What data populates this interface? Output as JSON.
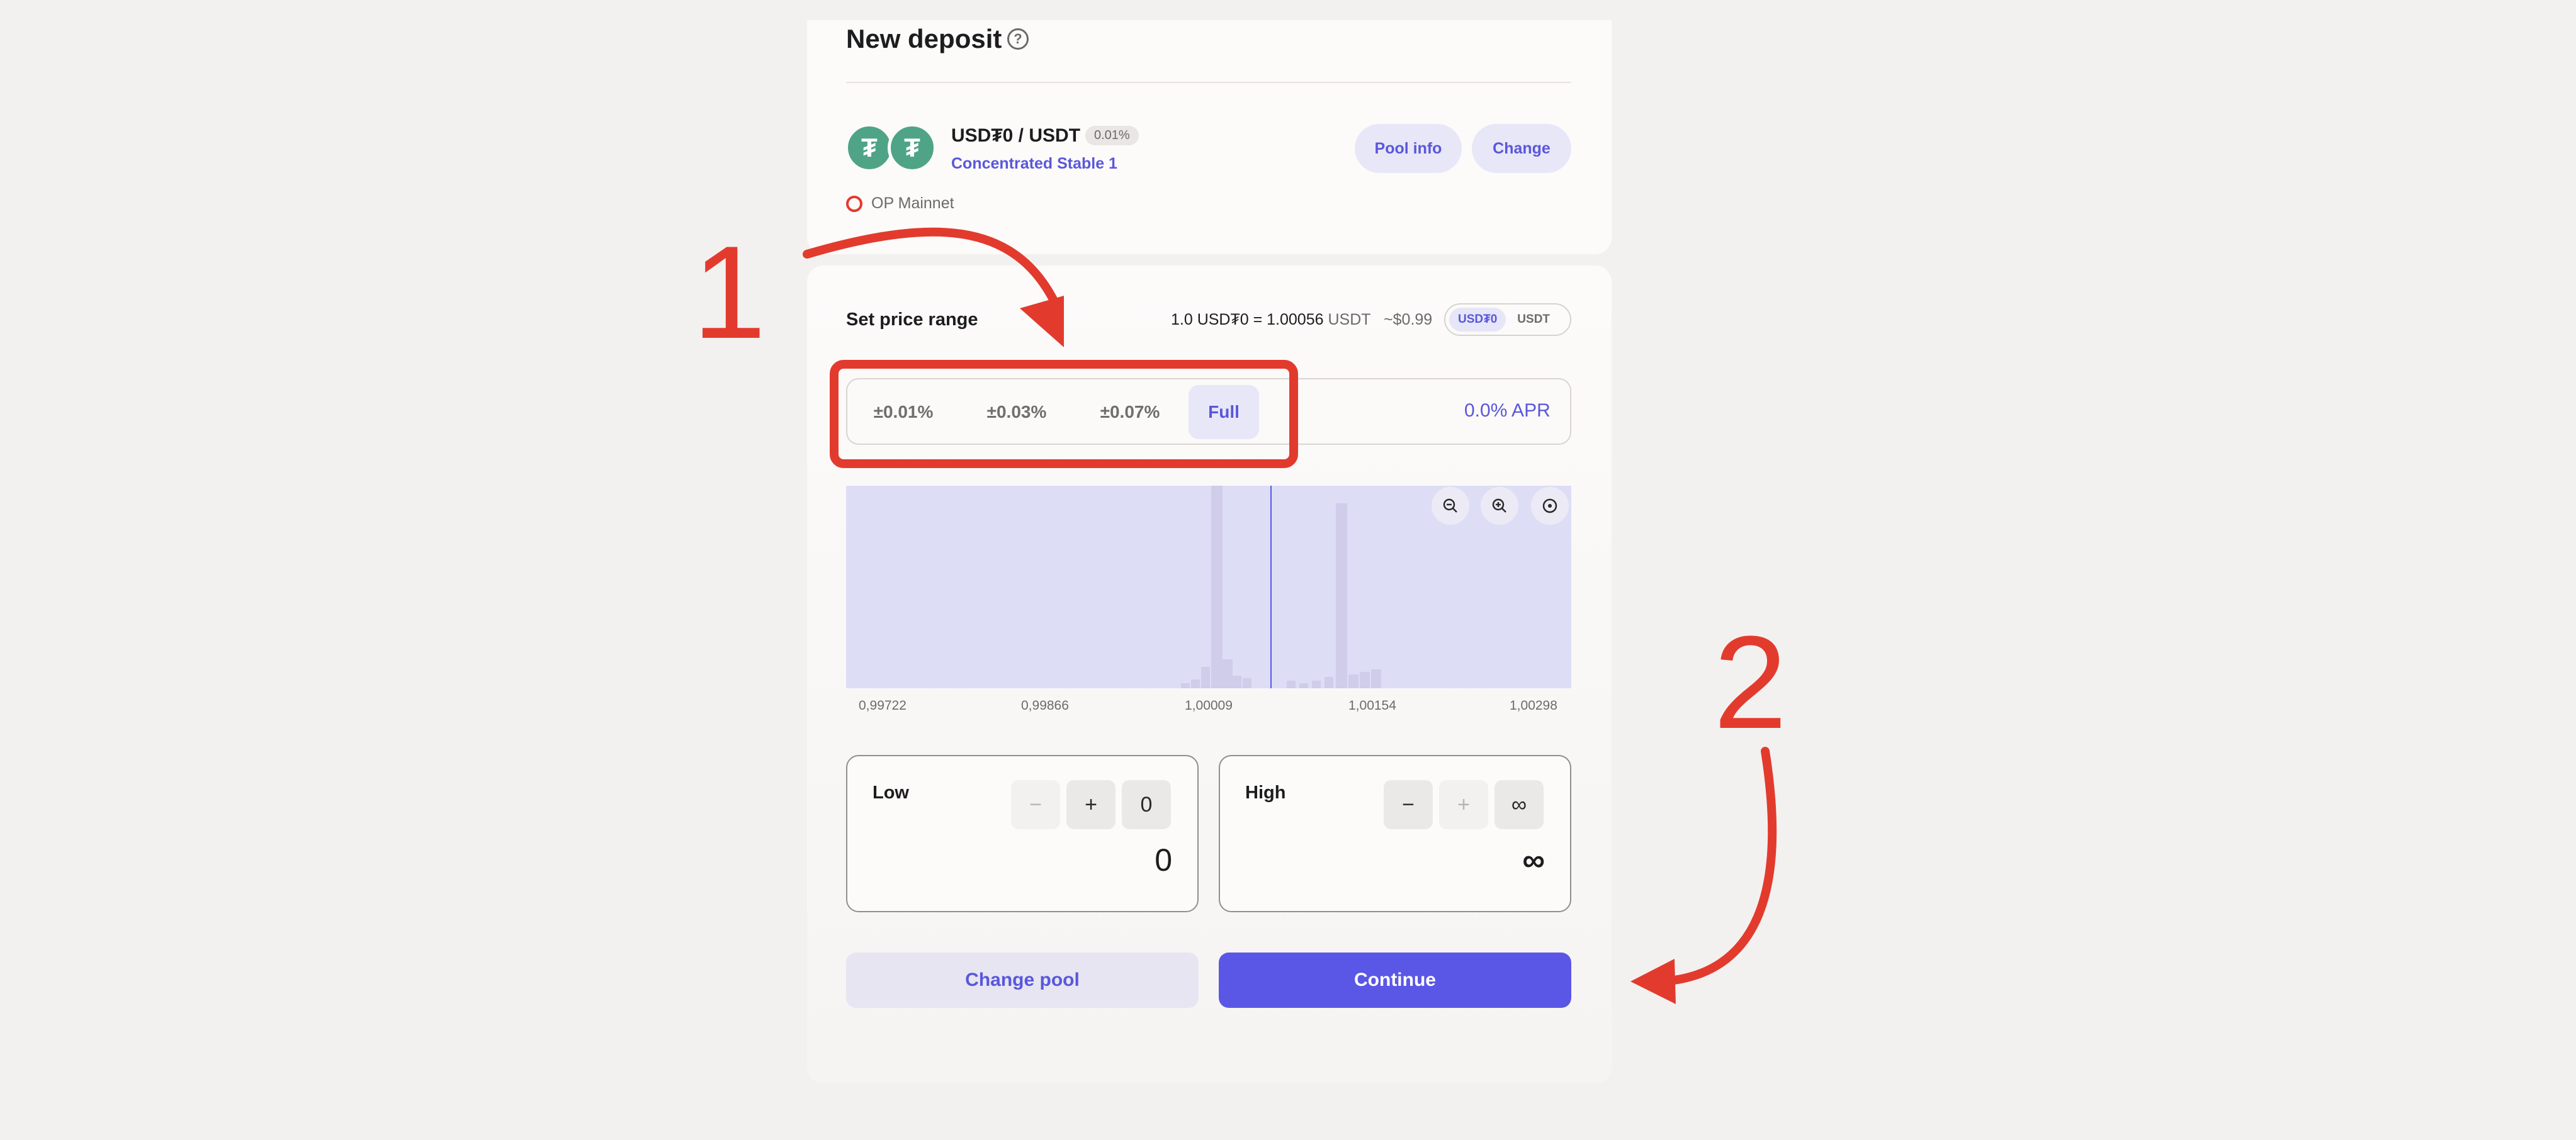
{
  "header": {
    "title": "New deposit",
    "help_icon": "help-circle-icon"
  },
  "pool": {
    "token_a_icon": "usdt0-token-icon",
    "token_b_icon": "usdt-token-icon",
    "pair": "USD₮0 / USDT",
    "fee": "0.01%",
    "type": "Concentrated Stable 1",
    "chain": "OP Mainnet",
    "pool_info_label": "Pool info",
    "change_label": "Change"
  },
  "range": {
    "title": "Set price range",
    "price_lead": "1.0 USD₮0 = 1.00056",
    "price_unit": "USDT",
    "price_usd": "~$0.99",
    "toggle": [
      "USD₮0",
      "USDT"
    ],
    "active_toggle": "USD₮0",
    "options": [
      "±0.01%",
      "±0.03%",
      "±0.07%",
      "Full"
    ],
    "active_option": "Full",
    "apr": "0.0% APR"
  },
  "chart": {
    "ticks": [
      "0,99722",
      "0,99866",
      "1,00009",
      "1,00154",
      "1,00298"
    ],
    "controls": [
      "zoom-out-icon",
      "zoom-in-icon",
      "reset-icon"
    ]
  },
  "low": {
    "label": "Low",
    "minus": "−",
    "plus": "+",
    "display": "0",
    "value": "0"
  },
  "high": {
    "label": "High",
    "minus": "−",
    "plus": "+",
    "display": "∞",
    "value": "∞"
  },
  "actions": {
    "change_pool": "Change pool",
    "continue": "Continue"
  },
  "annotations": {
    "one": "1",
    "two": "2",
    "color": "#e23b2e"
  },
  "colors": {
    "accent": "#5a57e6",
    "token": "#4fa488"
  }
}
